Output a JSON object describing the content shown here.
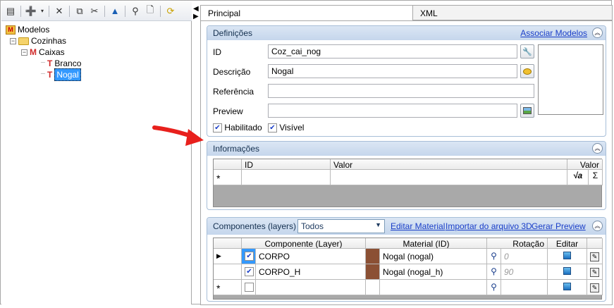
{
  "tree": {
    "root": "Modelos",
    "child": "Cozinhas",
    "grandchild": "Caixas",
    "leaf1": "Branco",
    "leaf2": "Nogal"
  },
  "tabs": {
    "principal": "Principal",
    "xml": "XML"
  },
  "definicoes": {
    "title": "Definições",
    "link": "Associar Modelos",
    "id_label": "ID",
    "id_value": "Coz_cai_nog",
    "desc_label": "Descrição",
    "desc_value": "Nogal",
    "ref_label": "Referência",
    "ref_value": "",
    "preview_label": "Preview",
    "preview_value": "",
    "habilitado": "Habilitado",
    "visivel": "Visível"
  },
  "informacoes": {
    "title": "Informações",
    "col_id": "ID",
    "col_valor": "Valor",
    "col_valor2": "Valor",
    "new_row_marker": "*"
  },
  "componentes": {
    "title": "Componentes (layers)",
    "filter_value": "Todos",
    "link_material": "Editar Material",
    "link_import": "Importar do arquivo 3D",
    "link_preview": "Gerar Preview",
    "col_componente": "Componente (Layer)",
    "col_material": "Material (ID)",
    "col_rotacao": "Rotação",
    "col_editar": "Editar",
    "rows": [
      {
        "componente": "CORPO",
        "material": "Nogal (nogal)",
        "rotacao": "0",
        "checked": true
      },
      {
        "componente": "CORPO_H",
        "material": "Nogal (nogal_h)",
        "rotacao": "90",
        "checked": true
      }
    ],
    "new_row_marker": "*"
  },
  "colors": {
    "accent": "#3399ff",
    "material_swatch": "#8b5034",
    "header": "#c5d6ec",
    "arrow": "#e8201c"
  }
}
